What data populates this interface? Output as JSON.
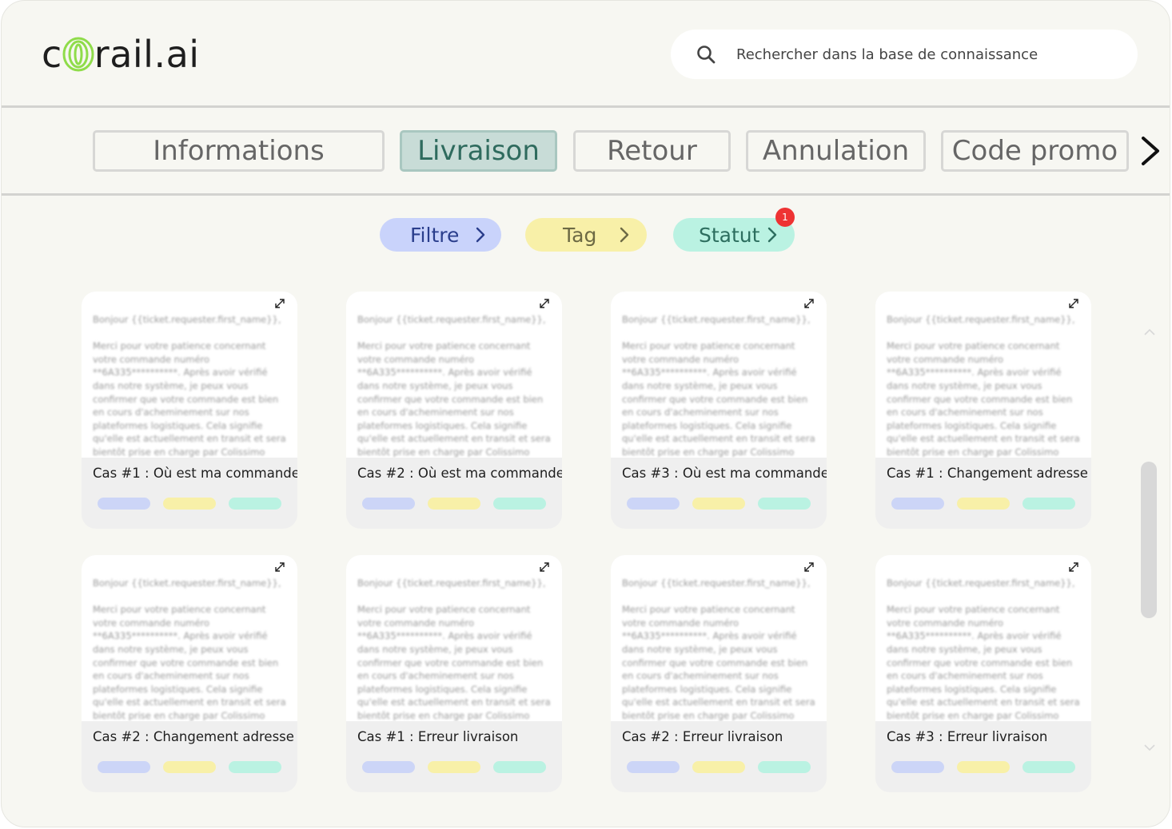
{
  "header": {
    "logo_prefix": "c",
    "logo_suffix": "rail.ai",
    "search_placeholder": "Rechercher dans la base de connaissance"
  },
  "tabs": [
    {
      "label": "Informations",
      "active": false
    },
    {
      "label": "Livraison",
      "active": true
    },
    {
      "label": "Retour",
      "active": false
    },
    {
      "label": "Annulation",
      "active": false
    },
    {
      "label": "Code promo",
      "active": false
    }
  ],
  "filters": {
    "filtre": {
      "label": "Filtre",
      "color": "#c9d3fb",
      "text_color": "#2a3e8c"
    },
    "tag": {
      "label": "Tag",
      "color": "#f8f0a8",
      "text_color": "#6d6a44"
    },
    "statut": {
      "label": "Statut",
      "color": "#baf2e2",
      "text_color": "#2d6e5f",
      "badge": "1"
    }
  },
  "pill_colors": [
    "#ccd5f7",
    "#f8f0a8",
    "#baf2e2"
  ],
  "card_preview": "Bonjour {{ticket.requester.first_name}},\n\nMerci pour votre patience concernant votre commande numéro **6A335**********. Après avoir vérifié dans notre système, je peux vous confirmer que votre commande est bien en cours d'acheminement sur nos plateformes logistiques. Cela signifie qu'elle est actuellement en transit et sera bientôt prise en charge par Colissimo",
  "cards": [
    {
      "title": "Cas #1 : Où est ma commande"
    },
    {
      "title": "Cas #2 : Où est ma commande"
    },
    {
      "title": "Cas #3 : Où est ma commande"
    },
    {
      "title": "Cas #1 : Changement adresse"
    },
    {
      "title": "Cas #2 : Changement adresse"
    },
    {
      "title": "Cas #1 : Erreur livraison"
    },
    {
      "title": "Cas #2 : Erreur livraison"
    },
    {
      "title": "Cas #3 : Erreur livraison"
    }
  ]
}
